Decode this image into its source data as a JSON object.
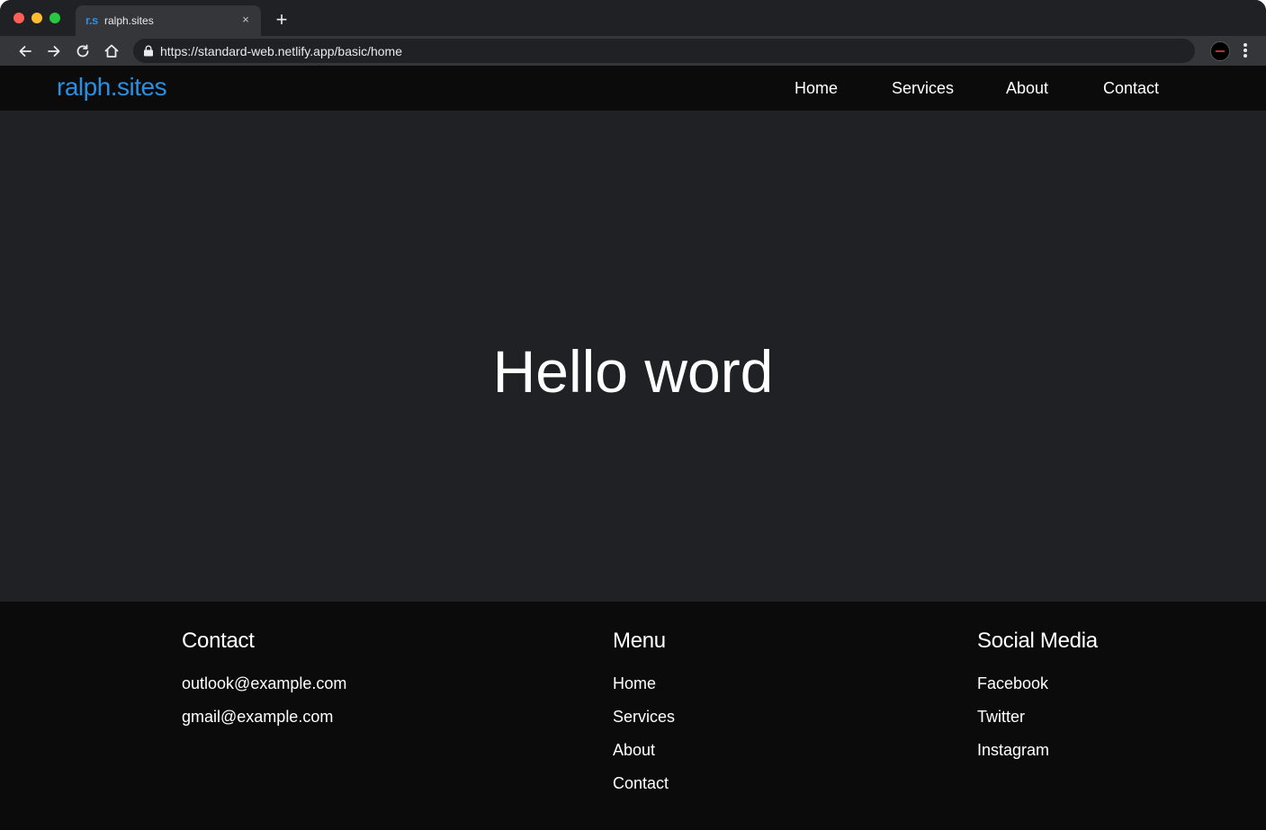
{
  "browser": {
    "tab": {
      "favicon_text": "r.s",
      "title": "ralph.sites",
      "close_symbol": "×"
    },
    "new_tab_symbol": "+",
    "url": "https://standard-web.netlify.app/basic/home"
  },
  "site": {
    "logo": "ralph.sites",
    "nav": [
      "Home",
      "Services",
      "About",
      "Contact"
    ],
    "hero_title": "Hello word"
  },
  "footer": {
    "contact": {
      "heading": "Contact",
      "items": [
        "outlook@example.com",
        "gmail@example.com"
      ]
    },
    "menu": {
      "heading": "Menu",
      "items": [
        "Home",
        "Services",
        "About",
        "Contact"
      ]
    },
    "social": {
      "heading": "Social Media",
      "items": [
        "Facebook",
        "Twitter",
        "Instagram"
      ]
    }
  },
  "colors": {
    "brand_blue": "#2a8fe0",
    "header_bg": "#0b0b0c",
    "hero_bg": "#202124"
  }
}
